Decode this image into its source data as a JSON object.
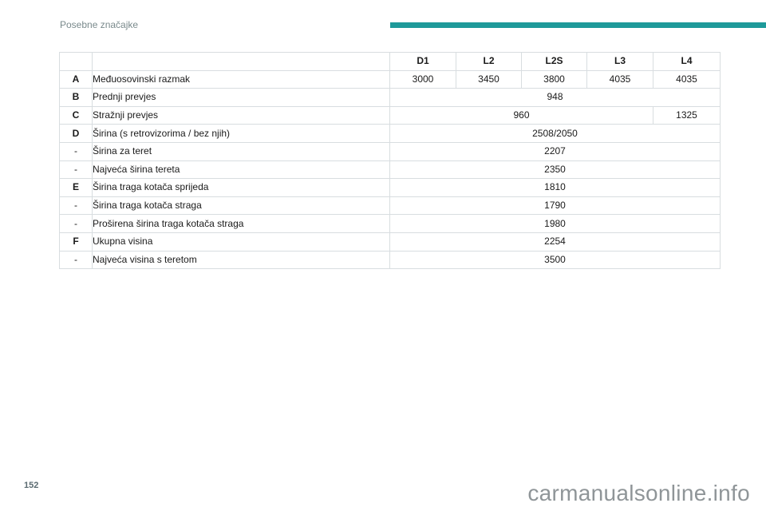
{
  "header": {
    "section": "Posebne značajke"
  },
  "columns": [
    "D1",
    "L2",
    "L2S",
    "L3",
    "L4"
  ],
  "rows": [
    {
      "code": "A",
      "label": "Međuosovinski razmak",
      "values": [
        "3000",
        "3450",
        "3800",
        "4035",
        "4035"
      ]
    },
    {
      "code": "B",
      "label": "Prednji prevjes",
      "values": [
        "948"
      ]
    },
    {
      "code": "C",
      "label": "Stražnji prevjes",
      "values": [
        "960",
        "1325"
      ]
    },
    {
      "code": "D",
      "label": "Širina (s retrovizorima / bez njih)",
      "values": [
        "2508/2050"
      ]
    },
    {
      "code": "-",
      "label": "Širina za teret",
      "values": [
        "2207"
      ]
    },
    {
      "code": "-",
      "label": "Najveća širina tereta",
      "values": [
        "2350"
      ]
    },
    {
      "code": "E",
      "label": "Širina traga kotača sprijeda",
      "values": [
        "1810"
      ]
    },
    {
      "code": "-",
      "label": "Širina traga kotača straga",
      "values": [
        "1790"
      ]
    },
    {
      "code": "-",
      "label": "Proširena širina traga kotača straga",
      "values": [
        "1980"
      ]
    },
    {
      "code": "F",
      "label": "Ukupna visina",
      "values": [
        "2254"
      ]
    },
    {
      "code": "-",
      "label": "Najveća visina s teretom",
      "values": [
        "3500"
      ]
    }
  ],
  "footer": {
    "page_number": "152",
    "watermark": "carmanualsonline.info"
  }
}
